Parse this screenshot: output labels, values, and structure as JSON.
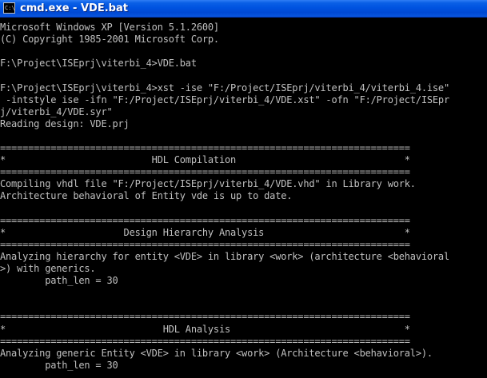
{
  "window": {
    "title": "cmd.exe - VDE.bat",
    "icon_glyph": "C:\\"
  },
  "console": {
    "lines": [
      "Microsoft Windows XP [Version 5.1.2600]",
      "(C) Copyright 1985-2001 Microsoft Corp.",
      "",
      "F:\\Project\\ISEprj\\viterbi_4>VDE.bat",
      "",
      "F:\\Project\\ISEprj\\viterbi_4>xst -ise \"F:/Project/ISEprj/viterbi_4/viterbi_4.ise\"",
      " -intstyle ise -ifn \"F:/Project/ISEprj/viterbi_4/VDE.xst\" -ofn \"F:/Project/ISEpr",
      "j/viterbi_4/VDE.syr\"",
      "Reading design: VDE.prj",
      "",
      "=========================================================================",
      "*                          HDL Compilation                              *",
      "=========================================================================",
      "Compiling vhdl file \"F:/Project/ISEprj/viterbi_4/VDE.vhd\" in Library work.",
      "Architecture behavioral of Entity vde is up to date.",
      "",
      "=========================================================================",
      "*                     Design Hierarchy Analysis                         *",
      "=========================================================================",
      "Analyzing hierarchy for entity <VDE> in library <work> (architecture <behavioral",
      ">) with generics.",
      "        path_len = 30",
      "",
      "",
      "=========================================================================",
      "*                            HDL Analysis                               *",
      "=========================================================================",
      "Analyzing generic Entity <VDE> in library <work> (Architecture <behavioral>).",
      "        path_len = 30"
    ]
  }
}
